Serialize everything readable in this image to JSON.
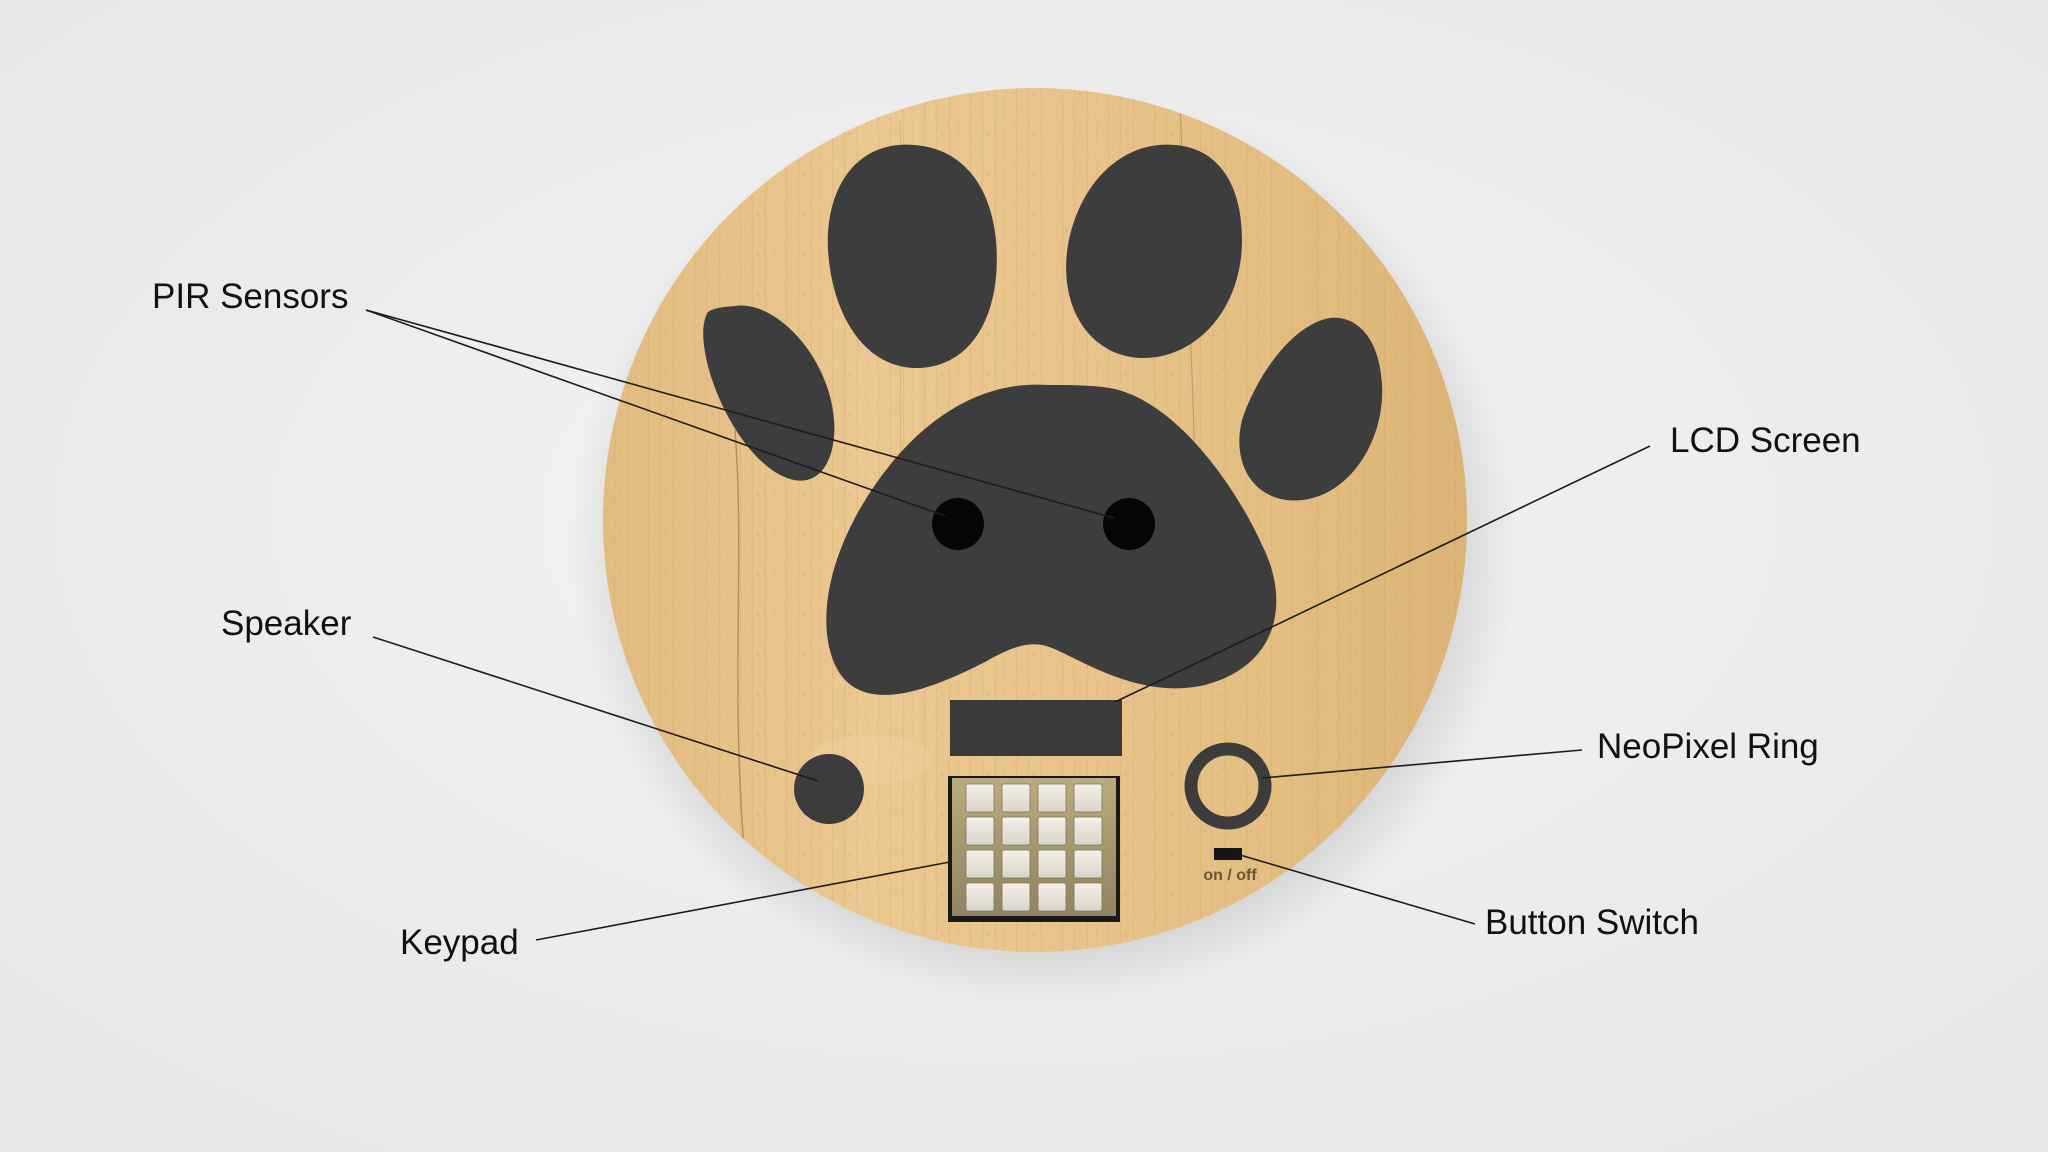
{
  "labels": {
    "pir_sensors": "PIR Sensors",
    "lcd_screen": "LCD Screen",
    "speaker": "Speaker",
    "neopixel_ring": "NeoPixel Ring",
    "keypad": "Keypad",
    "button_switch": "Button Switch",
    "switch_text": "on / off"
  },
  "colors": {
    "background": "#ececec",
    "wood": "#e6c288",
    "paw": "#3d3d3d",
    "sensor": "#050505",
    "leader": "#1c1c1c"
  },
  "keypad": {
    "rows": 4,
    "columns": 4
  }
}
